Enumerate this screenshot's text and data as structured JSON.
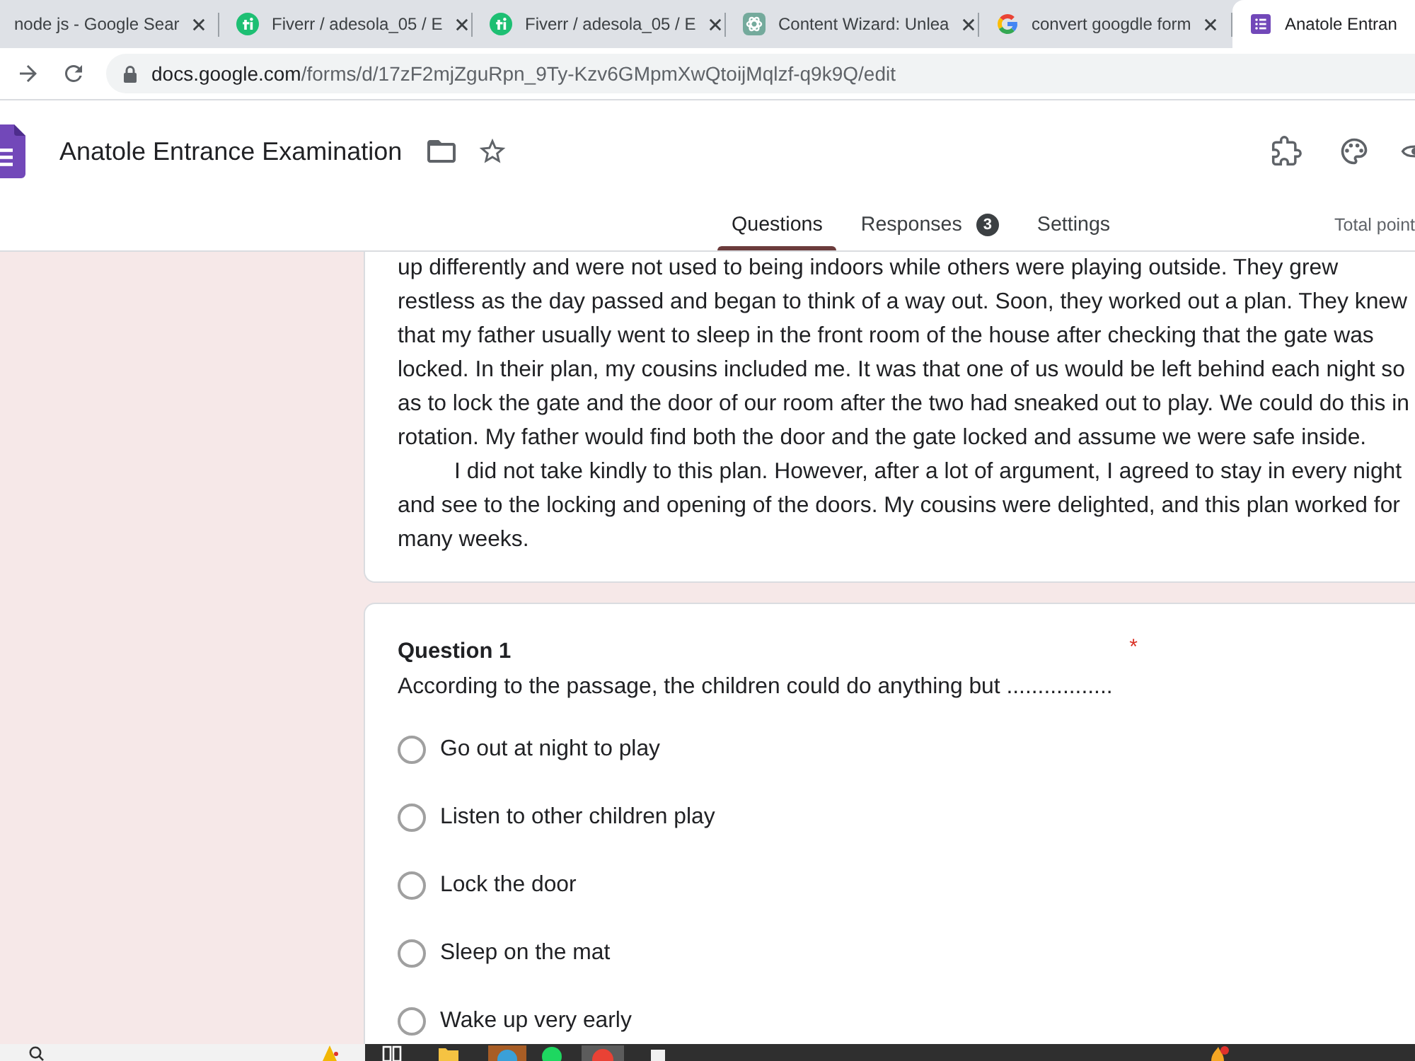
{
  "browser_tabs": [
    {
      "title": "node js - Google Sear",
      "kind": "plain",
      "selected": false
    },
    {
      "title": "Fiverr / adesola_05 / E",
      "kind": "circle",
      "selected": false
    },
    {
      "title": "Fiverr / adesola_05 / E",
      "kind": "circle",
      "selected": false
    },
    {
      "title": "Content Wizard: Unlea",
      "kind": "knot",
      "selected": false
    },
    {
      "title": "convert googdle form",
      "kind": "ring",
      "selected": false
    },
    {
      "title": "Anatole Entran",
      "kind": "form",
      "selected": true
    }
  ],
  "address_bar": {
    "host": "docs.google.com",
    "path": "/forms/d/17zF2mjZguRpn_9Ty-Kzv6GMpmXwQtoijMqlzf-q9k9Q/edit"
  },
  "form_header": {
    "title": "Anatole Entrance Examination",
    "tabs": [
      {
        "label": "Questions",
        "selected": true
      },
      {
        "label": "Responses",
        "badge": "3",
        "selected": false
      },
      {
        "label": "Settings",
        "selected": false
      }
    ],
    "total_points": "Total point"
  },
  "passage": {
    "paragraphs": [
      {
        "indented": false,
        "lines": [
          "up differently and were not used to being indoors while others were playing outside. They grew",
          "restless as the day passed and began to think of a way out. Soon, they worked out a plan. They knew",
          "that my father usually went to sleep in the front room of the house after checking that the gate was",
          "locked. In their plan, my cousins included me. It was that one of us would be left behind each night so",
          "as to lock the gate and the door of our room after the two had sneaked out to play. We could do this in",
          "rotation. My father would find both the door and the gate locked and assume we were safe inside."
        ]
      },
      {
        "indented": true,
        "lines": [
          "I did not take kindly to this plan. However, after a lot of argument, I agreed to stay in every night",
          "and see to the locking and opening of the doors. My cousins were delighted, and this plan worked for",
          "many weeks."
        ]
      }
    ]
  },
  "question": {
    "title": "Question 1",
    "required_mark": "*",
    "text": "According to the passage, the children could do anything but .................",
    "options": [
      {
        "label": "Go out at night to play",
        "selected": false
      },
      {
        "label": "Listen to other children play",
        "selected": false
      },
      {
        "label": "Lock the door",
        "selected": false
      },
      {
        "label": "Sleep on the mat",
        "selected": false
      },
      {
        "label": "Wake up very early",
        "selected": false
      }
    ]
  }
}
